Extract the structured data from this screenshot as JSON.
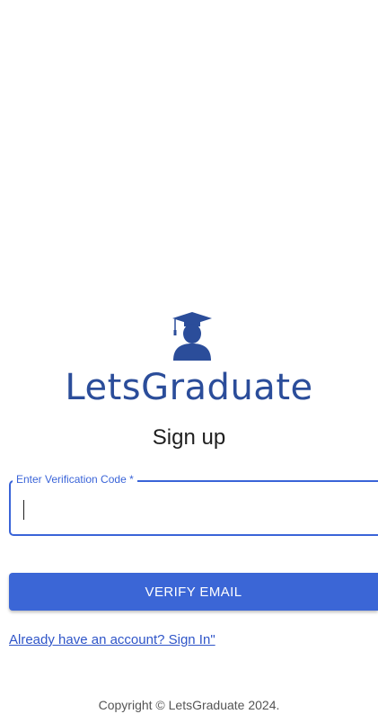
{
  "brand": {
    "name": "LetsGraduate",
    "icon": "graduate-icon",
    "color": "#2b4d9a"
  },
  "form": {
    "heading": "Sign up",
    "code_field": {
      "label": "Enter Verification Code *",
      "value": "",
      "placeholder": ""
    },
    "verify_button_label": "VERIFY EMAIL",
    "signin_link": "Already have an account? Sign In\""
  },
  "footer": {
    "copyright": "Copyright © LetsGraduate 2024."
  },
  "colors": {
    "accent": "#3b66d6",
    "link": "#2f55c8"
  }
}
